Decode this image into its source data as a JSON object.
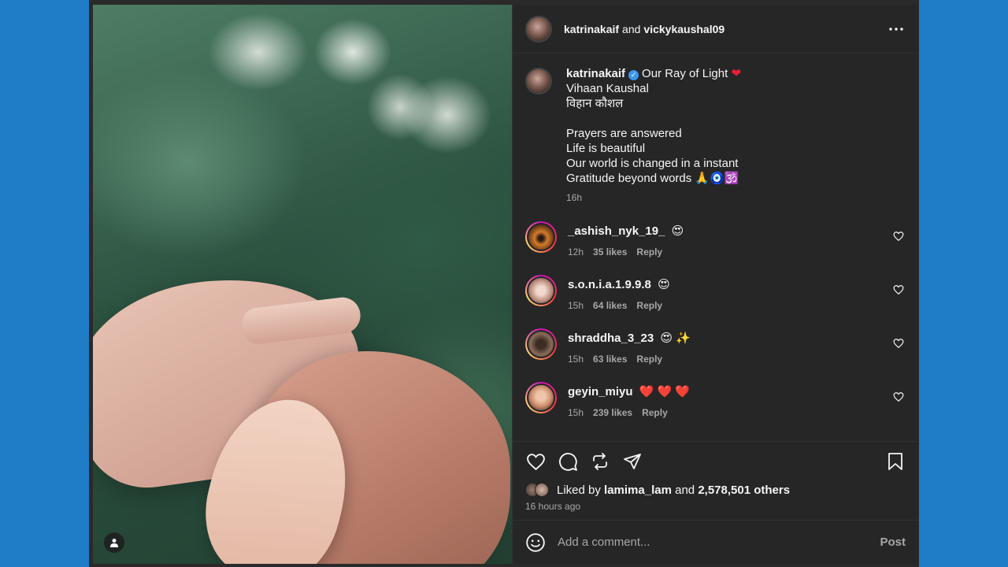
{
  "header": {
    "user1": "katrinakaif",
    "and": "and",
    "user2": "vickykaushal09"
  },
  "caption": {
    "username": "katrinakaif",
    "lines": [
      "Our Ray of Light",
      "Vihaan Kaushal",
      "विहान कौशल",
      "",
      "Prayers are answered",
      "Life is beautiful",
      "Our world is changed in a instant",
      "Gratitude beyond words 🙏🧿🕉️"
    ],
    "time": "16h"
  },
  "comments": [
    {
      "username": "_ashish_nyk_19_",
      "text": "😍",
      "time": "12h",
      "likes": "35 likes",
      "reply": "Reply"
    },
    {
      "username": "s.o.n.i.a.1.9.9.8",
      "text": "😍",
      "time": "15h",
      "likes": "64 likes",
      "reply": "Reply"
    },
    {
      "username": "shraddha_3_23",
      "text": "😍 ✨",
      "time": "15h",
      "likes": "63 likes",
      "reply": "Reply"
    },
    {
      "username": "geyin_miyu",
      "text": "❤️ ❤️ ❤️",
      "time": "15h",
      "likes": "239 likes",
      "reply": "Reply"
    }
  ],
  "likes": {
    "prefix": "Liked by",
    "user": "lamima_lam",
    "and": "and",
    "others": "2,578,501 others"
  },
  "post_time": "16 hours ago",
  "add_comment": {
    "placeholder": "Add a comment...",
    "post_label": "Post"
  },
  "colors": {
    "page_bg": "#1f7cc6",
    "panel_bg": "#262626",
    "verified": "#3897f0",
    "heart": "#ed1c3a"
  },
  "icons": [
    "more-icon",
    "verified-icon",
    "heart-icon",
    "comment-icon",
    "repost-icon",
    "share-icon",
    "bookmark-icon",
    "emoji-icon",
    "user-tag-icon"
  ]
}
